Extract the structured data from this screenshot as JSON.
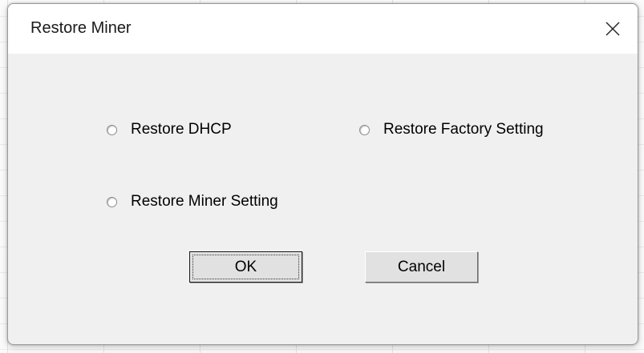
{
  "dialog": {
    "title": "Restore Miner",
    "close_icon": "close-icon",
    "options": [
      {
        "label": "Restore DHCP",
        "selected": false
      },
      {
        "label": "Restore Factory Setting",
        "selected": false
      },
      {
        "label": "Restore Miner Setting",
        "selected": false
      }
    ],
    "ok_label": "OK",
    "cancel_label": "Cancel"
  }
}
